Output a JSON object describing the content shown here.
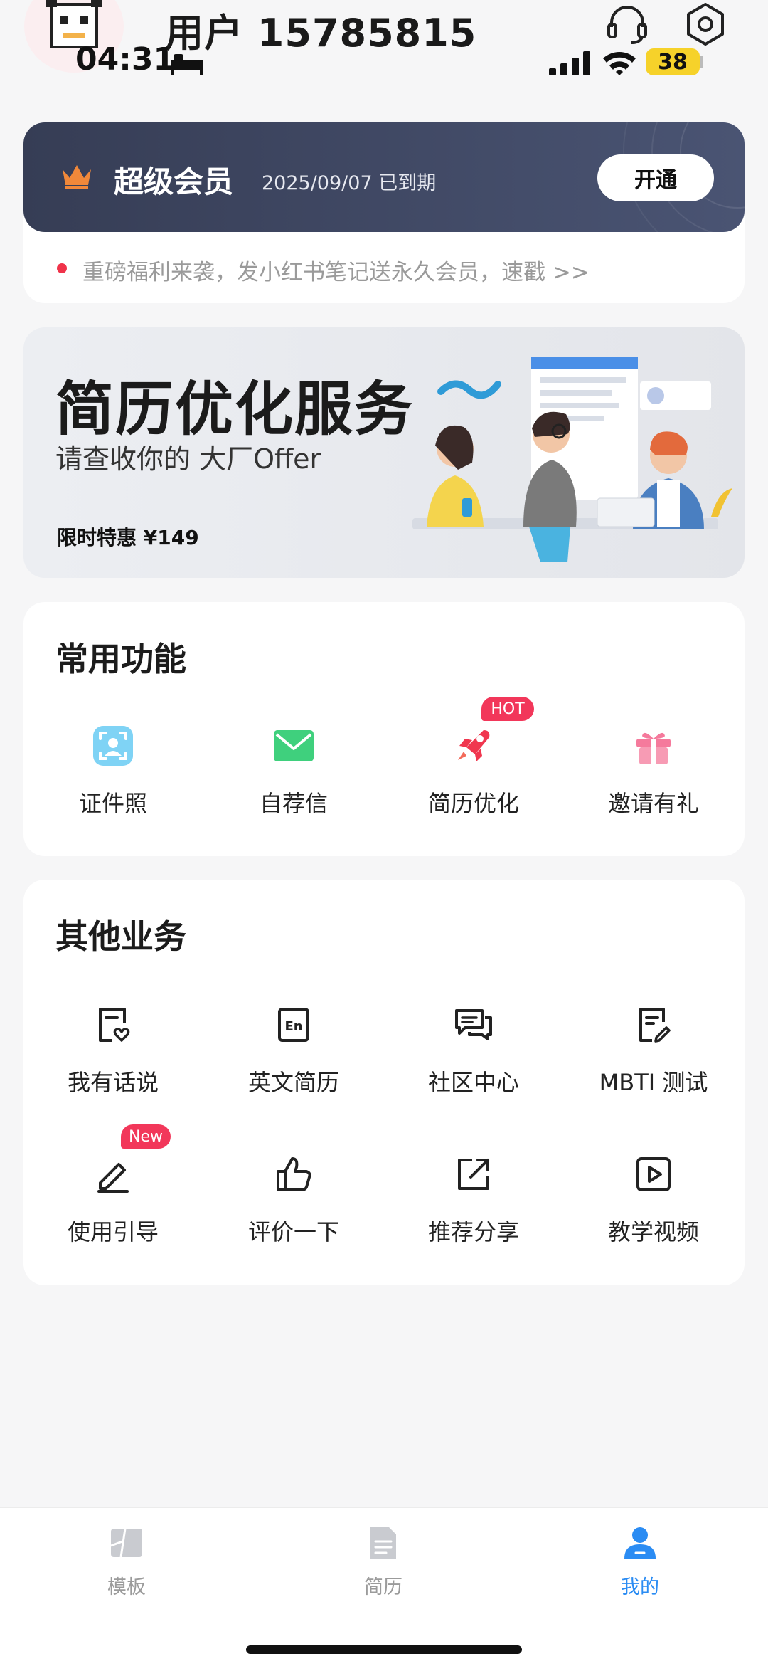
{
  "status_bar": {
    "time": "04:31",
    "battery": "38"
  },
  "header": {
    "username": "用户 15785815"
  },
  "vip": {
    "title": "超级会员",
    "expire_text": "2025/09/07 已到期",
    "open_button": "开通",
    "notice": "重磅福利来袭，发小红书笔记送永久会员，速戳 >>"
  },
  "banner": {
    "title": "简历优化服务",
    "subtitle": "请查收你的 大厂Offer",
    "price": "限时特惠 ¥149"
  },
  "common": {
    "title": "常用功能",
    "items": [
      {
        "label": "证件照",
        "icon": "id-photo-icon"
      },
      {
        "label": "自荐信",
        "icon": "mail-icon"
      },
      {
        "label": "简历优化",
        "icon": "rocket-icon",
        "badge": "HOT"
      },
      {
        "label": "邀请有礼",
        "icon": "gift-icon"
      }
    ]
  },
  "other": {
    "title": "其他业务",
    "items": [
      {
        "label": "我有话说",
        "icon": "feedback-icon"
      },
      {
        "label": "英文简历",
        "icon": "english-icon"
      },
      {
        "label": "社区中心",
        "icon": "community-icon"
      },
      {
        "label": "MBTI 测试",
        "icon": "test-icon"
      },
      {
        "label": "使用引导",
        "icon": "pen-icon",
        "badge": "New"
      },
      {
        "label": "评价一下",
        "icon": "thumbs-up-icon"
      },
      {
        "label": "推荐分享",
        "icon": "share-icon"
      },
      {
        "label": "教学视频",
        "icon": "video-icon"
      }
    ]
  },
  "tabs": [
    {
      "label": "模板",
      "icon": "template-icon",
      "active": false
    },
    {
      "label": "简历",
      "icon": "resume-icon",
      "active": false
    },
    {
      "label": "我的",
      "icon": "profile-icon",
      "active": true
    }
  ],
  "colors": {
    "accent": "#2b8cf3",
    "vip_bg": "#363d55",
    "badge": "#f2375a",
    "crown": "#f0883a"
  }
}
